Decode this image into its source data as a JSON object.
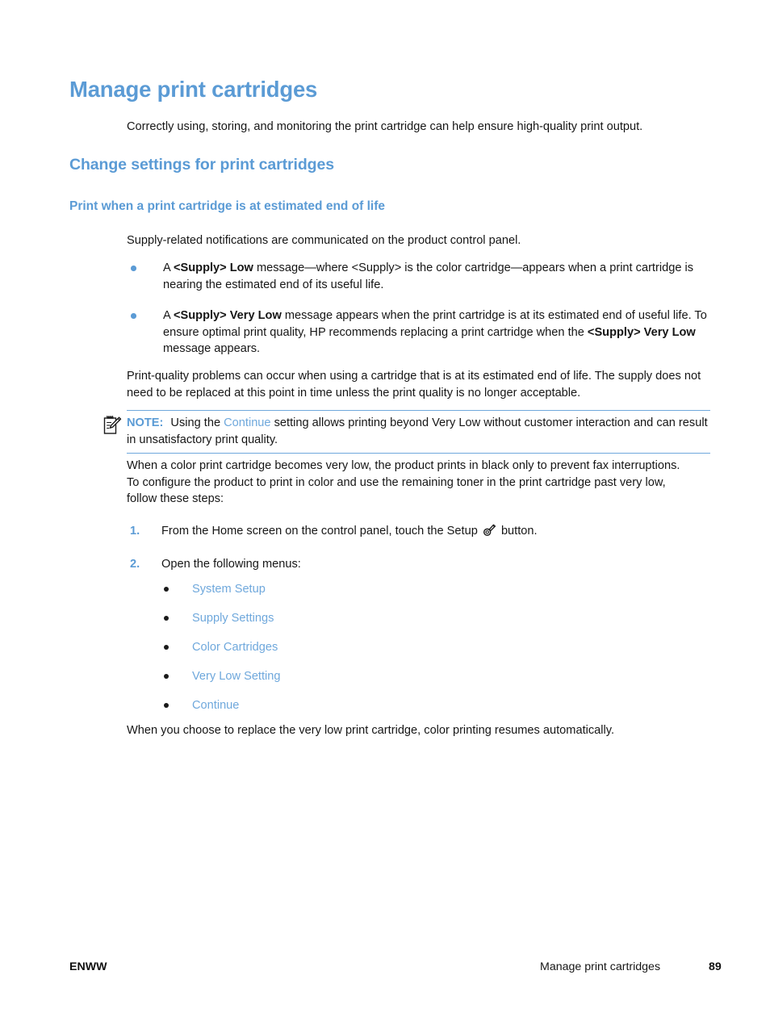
{
  "document": {
    "title": "Manage print cartridges",
    "section_heading": "Change settings for print cartridges",
    "subsection_heading": "Print when a print cartridge is at estimated end of life",
    "intro_paragraph": "Correctly using, storing, and monitoring the print cartridge can help ensure high-quality print output.",
    "supply_paragraph": "Supply-related notifications are communicated on the product control panel.",
    "quality_paragraph": "Print-quality problems can occur when using a cartridge that is at its estimated end of life. The supply does not need to be replaced at this point in time unless the print quality is no longer acceptable.",
    "when_paragraph": "When a color print cartridge becomes very low, the product prints in black only to prevent fax interruptions. To configure the product to print in color and use the remaining toner in the print cartridge past very low, follow these steps:",
    "final_paragraph": "When you choose to replace the very low print cartridge, color printing resumes automatically."
  },
  "bullets": [
    {
      "part1": "A ",
      "bold1": "<Supply> Low",
      "part2": " message—where <Supply> is the color cartridge—appears when a print cartridge is nearing the estimated end of its useful life.",
      "bold2": "",
      "part3": ""
    },
    {
      "part1": "A ",
      "bold1": "<Supply> Very Low",
      "part2": " message appears when the print cartridge is at its estimated end of useful life. To ensure optimal print quality, HP recommends replacing a print cartridge when the ",
      "bold2": "<Supply> Very Low",
      "part3": " message appears."
    }
  ],
  "note": {
    "icon": "note-clipboard-pencil-icon",
    "label": "NOTE:",
    "text_before": "Using the ",
    "ui_term": "Continue",
    "text_after": " setting allows printing beyond Very Low without customer interaction and can result in unsatisfactory print quality."
  },
  "steps": [
    {
      "number": "1.",
      "text_before": "From the Home screen on the control panel, touch the Setup ",
      "icon": "setup-wrench-icon",
      "text_after": " button."
    },
    {
      "number": "2.",
      "text_before": "Open the following menus:",
      "icon": "",
      "text_after": ""
    }
  ],
  "menu_path": [
    {
      "label": "System Setup"
    },
    {
      "label": "Supply Settings"
    },
    {
      "label": "Color Cartridges"
    },
    {
      "label": "Very Low Setting"
    },
    {
      "label": "Continue"
    }
  ],
  "footer": {
    "left": "ENWW",
    "title": "Manage print cartridges",
    "page_number": "89"
  },
  "colors": {
    "heading_blue": "#5B9BD5",
    "link_blue": "#6FA8DC",
    "body_black": "#161616",
    "rule_blue": "#6FA8DC"
  }
}
